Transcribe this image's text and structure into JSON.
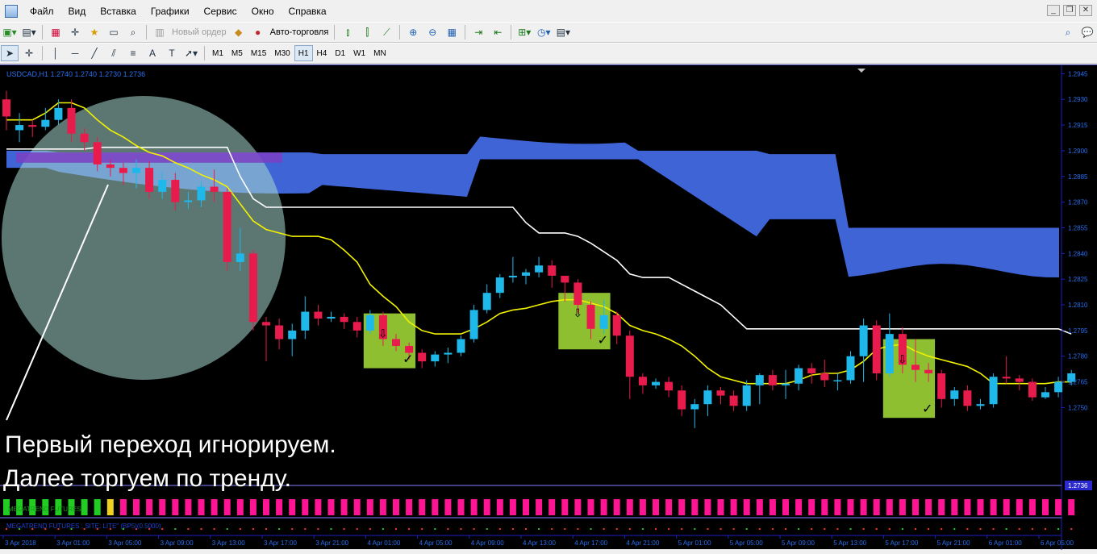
{
  "menu": [
    "Файл",
    "Вид",
    "Вставка",
    "Графики",
    "Сервис",
    "Окно",
    "Справка"
  ],
  "toolbar1": {
    "new_order": "Новый ордер",
    "auto_trading": "Авто-торговля"
  },
  "timeframes": [
    "M1",
    "M5",
    "M15",
    "M30",
    "H1",
    "H4",
    "D1",
    "W1",
    "MN"
  ],
  "active_timeframe": "H1",
  "chart_info": "USDCAD,H1  1.2740 1.2740 1.2730 1.2736",
  "annotation": {
    "line1": "Первый переход игнорируем.",
    "line2": "Далее торгуем по тренду."
  },
  "indicator1_label": "MEGATREND FUTURES",
  "indicator2_label": "MEGATREND FUTURES  : SITE: LITE\"  (BP5)(0.5000)",
  "current_price_tag": "1.2736",
  "colors": {
    "bull": "#1fb8ea",
    "bear": "#e81c4c",
    "cloud": "#4169e1",
    "cloud_bear": "#7b3fc4",
    "yellow": "#f2f200",
    "white": "#ffffff",
    "box": "#9dd436",
    "axis": "#2020c0"
  },
  "chart_data": {
    "type": "candlestick",
    "symbol": "USDCAD",
    "timeframe": "H1",
    "ylim": [
      1.2705,
      1.2948
    ],
    "y_ticks": [
      "1.2945",
      "1.2930",
      "1.2915",
      "1.2900",
      "1.2885",
      "1.2870",
      "1.2855",
      "1.2840",
      "1.2825",
      "1.2810",
      "1.2795",
      "1.2780",
      "1.2765",
      "1.2750"
    ],
    "x_ticks": [
      "3 Apr 2018",
      "3 Apr 01:00",
      "3 Apr 05:00",
      "3 Apr 09:00",
      "3 Apr 13:00",
      "3 Apr 17:00",
      "3 Apr 21:00",
      "4 Apr 01:00",
      "4 Apr 05:00",
      "4 Apr 09:00",
      "4 Apr 13:00",
      "4 Apr 17:00",
      "4 Apr 21:00",
      "5 Apr 01:00",
      "5 Apr 05:00",
      "5 Apr 09:00",
      "5 Apr 13:00",
      "5 Apr 17:00",
      "5 Apr 21:00",
      "6 Apr 01:00",
      "6 Apr 05:00"
    ],
    "candles": [
      [
        1.293,
        1.292,
        1.2935,
        1.2912
      ],
      [
        1.2912,
        1.2915,
        1.2922,
        1.2905
      ],
      [
        1.2915,
        1.2914,
        1.2918,
        1.2908
      ],
      [
        1.2914,
        1.2918,
        1.2925,
        1.2912
      ],
      [
        1.2918,
        1.2925,
        1.293,
        1.2915
      ],
      [
        1.2925,
        1.291,
        1.293,
        1.2905
      ],
      [
        1.291,
        1.2905,
        1.2913,
        1.29
      ],
      [
        1.2905,
        1.2892,
        1.2908,
        1.2888
      ],
      [
        1.2892,
        1.289,
        1.2895,
        1.2885
      ],
      [
        1.289,
        1.2887,
        1.2893,
        1.288
      ],
      [
        1.2887,
        1.289,
        1.2895,
        1.2878
      ],
      [
        1.289,
        1.2876,
        1.2894,
        1.2872
      ],
      [
        1.2876,
        1.2883,
        1.2888,
        1.2872
      ],
      [
        1.2883,
        1.287,
        1.2887,
        1.2865
      ],
      [
        1.287,
        1.2871,
        1.2876,
        1.2866
      ],
      [
        1.2871,
        1.2879,
        1.2882,
        1.2867
      ],
      [
        1.2879,
        1.2876,
        1.2889,
        1.287
      ],
      [
        1.2876,
        1.2835,
        1.2878,
        1.283
      ],
      [
        1.2835,
        1.284,
        1.2855,
        1.283
      ],
      [
        1.284,
        1.28,
        1.2842,
        1.2795
      ],
      [
        1.28,
        1.2798,
        1.2803,
        1.2777
      ],
      [
        1.2798,
        1.279,
        1.2802,
        1.2784
      ],
      [
        1.279,
        1.2795,
        1.2799,
        1.278
      ],
      [
        1.2795,
        1.2806,
        1.2815,
        1.279
      ],
      [
        1.2806,
        1.2802,
        1.281,
        1.2798
      ],
      [
        1.2802,
        1.2803,
        1.2806,
        1.28
      ],
      [
        1.2803,
        1.28,
        1.2805,
        1.2796
      ],
      [
        1.28,
        1.2795,
        1.2803,
        1.2791
      ],
      [
        1.2795,
        1.2804,
        1.2807,
        1.2793
      ],
      [
        1.2804,
        1.279,
        1.2806,
        1.2786
      ],
      [
        1.279,
        1.2786,
        1.2793,
        1.2783
      ],
      [
        1.2786,
        1.2782,
        1.2788,
        1.2778
      ],
      [
        1.2782,
        1.2777,
        1.2784,
        1.2773
      ],
      [
        1.2777,
        1.2781,
        1.2783,
        1.2774
      ],
      [
        1.2781,
        1.2782,
        1.2785,
        1.2776
      ],
      [
        1.2782,
        1.279,
        1.2792,
        1.278
      ],
      [
        1.279,
        1.2807,
        1.281,
        1.2788
      ],
      [
        1.2807,
        1.2817,
        1.2822,
        1.2805
      ],
      [
        1.2817,
        1.2826,
        1.2828,
        1.2814
      ],
      [
        1.2826,
        1.2827,
        1.2838,
        1.2823
      ],
      [
        1.2827,
        1.2829,
        1.2831,
        1.2822
      ],
      [
        1.2829,
        1.2833,
        1.2838,
        1.2826
      ],
      [
        1.2833,
        1.2827,
        1.2836,
        1.282
      ],
      [
        1.2827,
        1.2823,
        1.2826,
        1.2812
      ],
      [
        1.2823,
        1.281,
        1.2825,
        1.2805
      ],
      [
        1.281,
        1.2796,
        1.2812,
        1.279
      ],
      [
        1.2796,
        1.2804,
        1.2813,
        1.2793
      ],
      [
        1.2804,
        1.2792,
        1.2806,
        1.2787
      ],
      [
        1.2792,
        1.2768,
        1.2795,
        1.2755
      ],
      [
        1.2768,
        1.2763,
        1.277,
        1.2758
      ],
      [
        1.2763,
        1.2765,
        1.2767,
        1.2761
      ],
      [
        1.2765,
        1.276,
        1.2768,
        1.2756
      ],
      [
        1.276,
        1.2749,
        1.2763,
        1.2745
      ],
      [
        1.2749,
        1.2752,
        1.2755,
        1.2738
      ],
      [
        1.2752,
        1.276,
        1.2763,
        1.2745
      ],
      [
        1.276,
        1.2757,
        1.2762,
        1.2752
      ],
      [
        1.2757,
        1.2751,
        1.276,
        1.2748
      ],
      [
        1.2751,
        1.2763,
        1.2766,
        1.2748
      ],
      [
        1.2763,
        1.2769,
        1.277,
        1.2752
      ],
      [
        1.2769,
        1.2763,
        1.2772,
        1.276
      ],
      [
        1.2763,
        1.2764,
        1.2772,
        1.2755
      ],
      [
        1.2764,
        1.2773,
        1.2775,
        1.276
      ],
      [
        1.2773,
        1.277,
        1.2776,
        1.2764
      ],
      [
        1.277,
        1.2766,
        1.2778,
        1.2762
      ],
      [
        1.2766,
        1.2766,
        1.277,
        1.276
      ],
      [
        1.2766,
        1.278,
        1.2783,
        1.2764
      ],
      [
        1.278,
        1.2798,
        1.2802,
        1.2765
      ],
      [
        1.2798,
        1.277,
        1.2801,
        1.2766
      ],
      [
        1.277,
        1.2793,
        1.2805,
        1.2768
      ],
      [
        1.2793,
        1.2775,
        1.2797,
        1.277
      ],
      [
        1.2775,
        1.2772,
        1.279,
        1.2765
      ],
      [
        1.2772,
        1.277,
        1.2776,
        1.2765
      ],
      [
        1.277,
        1.2755,
        1.2772,
        1.275
      ],
      [
        1.2755,
        1.276,
        1.2762,
        1.2751
      ],
      [
        1.276,
        1.2751,
        1.2763,
        1.2748
      ],
      [
        1.2751,
        1.2752,
        1.2755,
        1.2749
      ],
      [
        1.2752,
        1.2768,
        1.277,
        1.275
      ],
      [
        1.2768,
        1.2767,
        1.278,
        1.2764
      ],
      [
        1.2767,
        1.2765,
        1.2769,
        1.276
      ],
      [
        1.2765,
        1.2756,
        1.2767,
        1.2754
      ],
      [
        1.2756,
        1.2759,
        1.2762,
        1.2755
      ],
      [
        1.2759,
        1.2765,
        1.2768,
        1.2756
      ],
      [
        1.2765,
        1.277,
        1.2772,
        1.2763
      ]
    ],
    "tenkan": [
      1.2918,
      1.2918,
      1.2918,
      1.2922,
      1.2928,
      1.2928,
      1.2925,
      1.2918,
      1.2912,
      1.2908,
      1.2903,
      1.2899,
      1.2897,
      1.2893,
      1.289,
      1.2886,
      1.2883,
      1.2879,
      1.2869,
      1.2859,
      1.2854,
      1.2852,
      1.285,
      1.285,
      1.285,
      1.2848,
      1.2842,
      1.2835,
      1.2822,
      1.2815,
      1.2809,
      1.28,
      1.2795,
      1.2793,
      1.2793,
      1.2793,
      1.2796,
      1.28,
      1.2805,
      1.2807,
      1.2808,
      1.281,
      1.2812,
      1.2813,
      1.2813,
      1.2811,
      1.2809,
      1.2805,
      1.2798,
      1.2795,
      1.2793,
      1.279,
      1.2786,
      1.278,
      1.2773,
      1.2768,
      1.2766,
      1.2764,
      1.2764,
      1.2764,
      1.2764,
      1.2766,
      1.2769,
      1.277,
      1.277,
      1.2772,
      1.2777,
      1.2784,
      1.2786,
      1.2787,
      1.2783,
      1.278,
      1.2778,
      1.2776,
      1.2774,
      1.277,
      1.2764,
      1.2764,
      1.2764,
      1.2764,
      1.2764,
      1.2765,
      1.2765
    ],
    "kijun": [
      1.2901,
      1.2901,
      1.2901,
      1.2901,
      1.2901,
      1.2901,
      1.2901,
      1.2902,
      1.2902,
      1.2902,
      1.2902,
      1.2902,
      1.2902,
      1.2902,
      1.2902,
      1.2902,
      1.2902,
      1.2902,
      1.2885,
      1.2872,
      1.2867,
      1.2867,
      1.2867,
      1.2867,
      1.2867,
      1.2867,
      1.2867,
      1.2867,
      1.2867,
      1.2867,
      1.2867,
      1.2867,
      1.2867,
      1.2867,
      1.2867,
      1.2867,
      1.2867,
      1.2867,
      1.2867,
      1.2867,
      1.2858,
      1.2852,
      1.2852,
      1.2852,
      1.285,
      1.2846,
      1.2841,
      1.2836,
      1.2828,
      1.2826,
      1.2826,
      1.2826,
      1.2822,
      1.2818,
      1.2814,
      1.281,
      1.2803,
      1.2796,
      1.2796,
      1.2796,
      1.2796,
      1.2796,
      1.2796,
      1.2796,
      1.2796,
      1.2796,
      1.2796,
      1.2796,
      1.2796,
      1.2796,
      1.2796,
      1.2796,
      1.2796,
      1.2796,
      1.2796,
      1.2796,
      1.2796,
      1.2796,
      1.2796,
      1.2796,
      1.2796,
      1.2796,
      1.2793
    ],
    "signal_boxes": [
      {
        "from": 28,
        "to": 31,
        "hi": 1.2805,
        "lo": 1.2773
      },
      {
        "from": 43,
        "to": 46,
        "hi": 1.2817,
        "lo": 1.2784
      },
      {
        "from": 68,
        "to": 71,
        "hi": 1.279,
        "lo": 1.2744
      }
    ]
  }
}
